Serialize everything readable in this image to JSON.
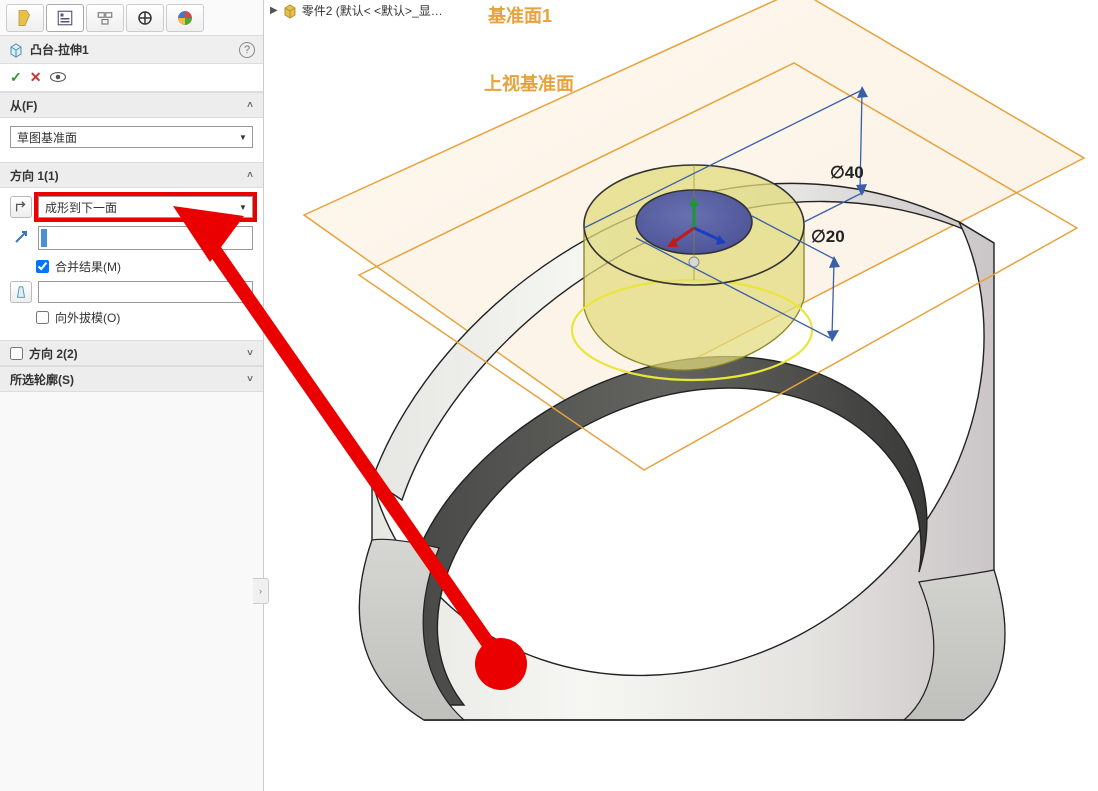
{
  "tabs": {
    "count": 5
  },
  "feature": {
    "title": "凸台-拉伸1",
    "help_tooltip": "?"
  },
  "confirm": {
    "ok": "✓",
    "cancel": "✕"
  },
  "from_section": {
    "header": "从(F)",
    "value": "草图基准面"
  },
  "dir1_section": {
    "header": "方向 1(1)",
    "end_condition": "成形到下一面",
    "merge_label": "合并结果(M)",
    "merge_checked": true,
    "draft_label": "向外拔模(O)",
    "draft_checked": false
  },
  "dir2_section": {
    "header": "方向 2(2)",
    "checked": false
  },
  "contours_section": {
    "header": "所选轮廓(S)"
  },
  "breadcrumb": {
    "part": "零件2  (默认< <默认>_显…"
  },
  "scene": {
    "plane1_label": "基准面1",
    "plane2_label": "上视基准面",
    "dim_outer": "∅40",
    "dim_inner": "∅20"
  }
}
